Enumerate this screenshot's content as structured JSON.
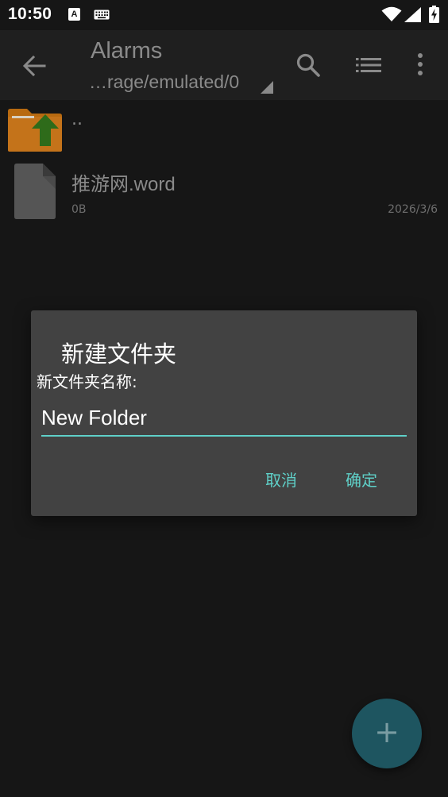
{
  "status_bar": {
    "time": "10:50",
    "a_badge": "A"
  },
  "toolbar": {
    "title": "Alarms",
    "path": "…rage/emulated/0"
  },
  "file_list": {
    "parent": {
      "label": ".."
    },
    "items": [
      {
        "name": "推游网.word",
        "size": "0B",
        "date": "2026/3/6",
        "icon": "document-icon"
      }
    ]
  },
  "dialog": {
    "title": "新建文件夹",
    "field_label": "新文件夹名称:",
    "input_value": "New Folder",
    "cancel_label": "取消",
    "ok_label": "确定"
  },
  "fab": {
    "label": "+"
  },
  "colors": {
    "accent": "#5fd0c8",
    "dialog_bg": "#424242",
    "folder": "#b86a10",
    "arrow": "#2e6b1a",
    "fab": "#1e5560"
  }
}
